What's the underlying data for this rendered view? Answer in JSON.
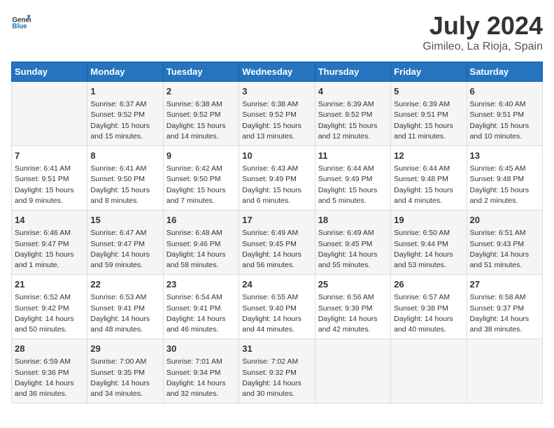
{
  "header": {
    "logo_general": "General",
    "logo_blue": "Blue",
    "title": "July 2024",
    "subtitle": "Gimileo, La Rioja, Spain"
  },
  "weekdays": [
    "Sunday",
    "Monday",
    "Tuesday",
    "Wednesday",
    "Thursday",
    "Friday",
    "Saturday"
  ],
  "weeks": [
    [
      {
        "day": "",
        "info": ""
      },
      {
        "day": "1",
        "info": "Sunrise: 6:37 AM\nSunset: 9:52 PM\nDaylight: 15 hours\nand 15 minutes."
      },
      {
        "day": "2",
        "info": "Sunrise: 6:38 AM\nSunset: 9:52 PM\nDaylight: 15 hours\nand 14 minutes."
      },
      {
        "day": "3",
        "info": "Sunrise: 6:38 AM\nSunset: 9:52 PM\nDaylight: 15 hours\nand 13 minutes."
      },
      {
        "day": "4",
        "info": "Sunrise: 6:39 AM\nSunset: 9:52 PM\nDaylight: 15 hours\nand 12 minutes."
      },
      {
        "day": "5",
        "info": "Sunrise: 6:39 AM\nSunset: 9:51 PM\nDaylight: 15 hours\nand 11 minutes."
      },
      {
        "day": "6",
        "info": "Sunrise: 6:40 AM\nSunset: 9:51 PM\nDaylight: 15 hours\nand 10 minutes."
      }
    ],
    [
      {
        "day": "7",
        "info": "Sunrise: 6:41 AM\nSunset: 9:51 PM\nDaylight: 15 hours\nand 9 minutes."
      },
      {
        "day": "8",
        "info": "Sunrise: 6:41 AM\nSunset: 9:50 PM\nDaylight: 15 hours\nand 8 minutes."
      },
      {
        "day": "9",
        "info": "Sunrise: 6:42 AM\nSunset: 9:50 PM\nDaylight: 15 hours\nand 7 minutes."
      },
      {
        "day": "10",
        "info": "Sunrise: 6:43 AM\nSunset: 9:49 PM\nDaylight: 15 hours\nand 6 minutes."
      },
      {
        "day": "11",
        "info": "Sunrise: 6:44 AM\nSunset: 9:49 PM\nDaylight: 15 hours\nand 5 minutes."
      },
      {
        "day": "12",
        "info": "Sunrise: 6:44 AM\nSunset: 9:48 PM\nDaylight: 15 hours\nand 4 minutes."
      },
      {
        "day": "13",
        "info": "Sunrise: 6:45 AM\nSunset: 9:48 PM\nDaylight: 15 hours\nand 2 minutes."
      }
    ],
    [
      {
        "day": "14",
        "info": "Sunrise: 6:46 AM\nSunset: 9:47 PM\nDaylight: 15 hours\nand 1 minute."
      },
      {
        "day": "15",
        "info": "Sunrise: 6:47 AM\nSunset: 9:47 PM\nDaylight: 14 hours\nand 59 minutes."
      },
      {
        "day": "16",
        "info": "Sunrise: 6:48 AM\nSunset: 9:46 PM\nDaylight: 14 hours\nand 58 minutes."
      },
      {
        "day": "17",
        "info": "Sunrise: 6:49 AM\nSunset: 9:45 PM\nDaylight: 14 hours\nand 56 minutes."
      },
      {
        "day": "18",
        "info": "Sunrise: 6:49 AM\nSunset: 9:45 PM\nDaylight: 14 hours\nand 55 minutes."
      },
      {
        "day": "19",
        "info": "Sunrise: 6:50 AM\nSunset: 9:44 PM\nDaylight: 14 hours\nand 53 minutes."
      },
      {
        "day": "20",
        "info": "Sunrise: 6:51 AM\nSunset: 9:43 PM\nDaylight: 14 hours\nand 51 minutes."
      }
    ],
    [
      {
        "day": "21",
        "info": "Sunrise: 6:52 AM\nSunset: 9:42 PM\nDaylight: 14 hours\nand 50 minutes."
      },
      {
        "day": "22",
        "info": "Sunrise: 6:53 AM\nSunset: 9:41 PM\nDaylight: 14 hours\nand 48 minutes."
      },
      {
        "day": "23",
        "info": "Sunrise: 6:54 AM\nSunset: 9:41 PM\nDaylight: 14 hours\nand 46 minutes."
      },
      {
        "day": "24",
        "info": "Sunrise: 6:55 AM\nSunset: 9:40 PM\nDaylight: 14 hours\nand 44 minutes."
      },
      {
        "day": "25",
        "info": "Sunrise: 6:56 AM\nSunset: 9:39 PM\nDaylight: 14 hours\nand 42 minutes."
      },
      {
        "day": "26",
        "info": "Sunrise: 6:57 AM\nSunset: 9:38 PM\nDaylight: 14 hours\nand 40 minutes."
      },
      {
        "day": "27",
        "info": "Sunrise: 6:58 AM\nSunset: 9:37 PM\nDaylight: 14 hours\nand 38 minutes."
      }
    ],
    [
      {
        "day": "28",
        "info": "Sunrise: 6:59 AM\nSunset: 9:36 PM\nDaylight: 14 hours\nand 36 minutes."
      },
      {
        "day": "29",
        "info": "Sunrise: 7:00 AM\nSunset: 9:35 PM\nDaylight: 14 hours\nand 34 minutes."
      },
      {
        "day": "30",
        "info": "Sunrise: 7:01 AM\nSunset: 9:34 PM\nDaylight: 14 hours\nand 32 minutes."
      },
      {
        "day": "31",
        "info": "Sunrise: 7:02 AM\nSunset: 9:32 PM\nDaylight: 14 hours\nand 30 minutes."
      },
      {
        "day": "",
        "info": ""
      },
      {
        "day": "",
        "info": ""
      },
      {
        "day": "",
        "info": ""
      }
    ]
  ]
}
